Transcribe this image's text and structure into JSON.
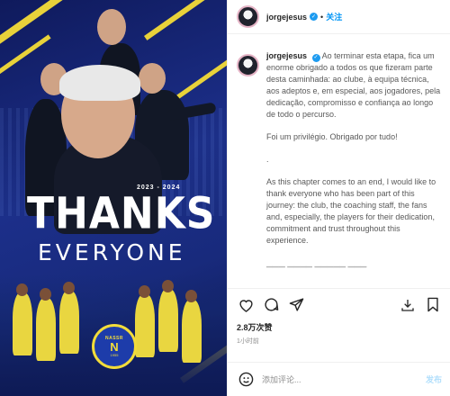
{
  "header": {
    "username": "jorgejesus",
    "follow_label": "关注",
    "separator": "•"
  },
  "media": {
    "dates": "2023 - 2024",
    "headline": "THANKS",
    "subheadline": "EVERYONE",
    "crest": {
      "top": "NASSR",
      "mid": "N",
      "bot": "1955"
    },
    "accent_color": "#e8d23a",
    "background_color": "#1c2f8a"
  },
  "caption": {
    "username": "jorgejesus",
    "paragraphs": [
      "Ao terminar esta etapa, fica um enorme obrigado a todos os que fizeram parte desta caminhada: ao clube, à equipa técnica, aos adeptos e, em especial, aos jogadores, pela dedicação, compromisso e confiança ao longo de todo o percurso.",
      "Foi um privilégio. Obrigado por tudo!",
      ".",
      "As this chapter comes to an end, I would like to thank everyone who has been part of this journey: the club, the coaching staff, the fans and, especially, the players for their dedication, commitment and trust throughout this experience."
    ]
  },
  "stats": {
    "likes": "2.8万次赞",
    "time": "1小时前"
  },
  "comment": {
    "placeholder": "添加评论...",
    "post_label": "发布"
  },
  "icons": {
    "like": "heart-icon",
    "comment": "comment-icon",
    "share": "share-icon",
    "save": "bookmark-icon",
    "emoji": "emoji-icon",
    "verified": "verified-badge-icon"
  }
}
